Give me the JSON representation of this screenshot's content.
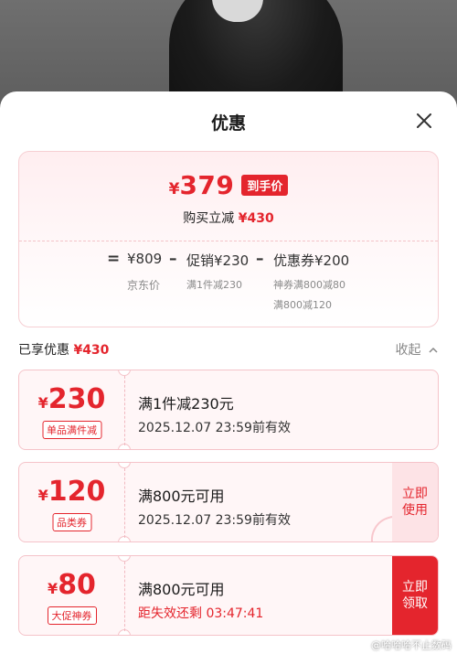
{
  "sheet": {
    "title": "优惠"
  },
  "summary": {
    "currency": "¥",
    "final_price": "379",
    "price_tag": "到手价",
    "save_label": "购买立减",
    "save_amount": "¥430",
    "formula": {
      "eq": "=",
      "minus": "–",
      "jd_price": "¥809",
      "jd_price_label": "京东价",
      "promo": "促销¥230",
      "promo_detail": "满1件减230",
      "coupon": "优惠券¥200",
      "coupon_detail_1": "神券满800减80",
      "coupon_detail_2": "满800减120"
    }
  },
  "section": {
    "title": "已享优惠",
    "amount": "¥430",
    "collapse_label": "收起"
  },
  "coupons": [
    {
      "currency": "¥",
      "amount": "230",
      "type": "单品满件减",
      "condition": "满1件减230元",
      "validity": "2025.12.07 23:59前有效"
    },
    {
      "currency": "¥",
      "amount": "120",
      "type": "品类券",
      "condition": "满800元可用",
      "validity": "2025.12.07 23:59前有效",
      "button_line1": "立即",
      "button_line2": "使用"
    },
    {
      "currency": "¥",
      "amount": "80",
      "type": "大促神券",
      "condition": "满800元可用",
      "validity": "距失效还剩 03:47:41",
      "button_line1": "立即",
      "button_line2": "领取"
    }
  ],
  "watermark": "@哈哈哈不止数码",
  "colors": {
    "accent": "#e4252d",
    "card_bg": "#fff6f7",
    "card_border": "#f5c3c9"
  },
  "icons": {
    "close": "close-icon",
    "collapse": "chevron-up-icon"
  }
}
